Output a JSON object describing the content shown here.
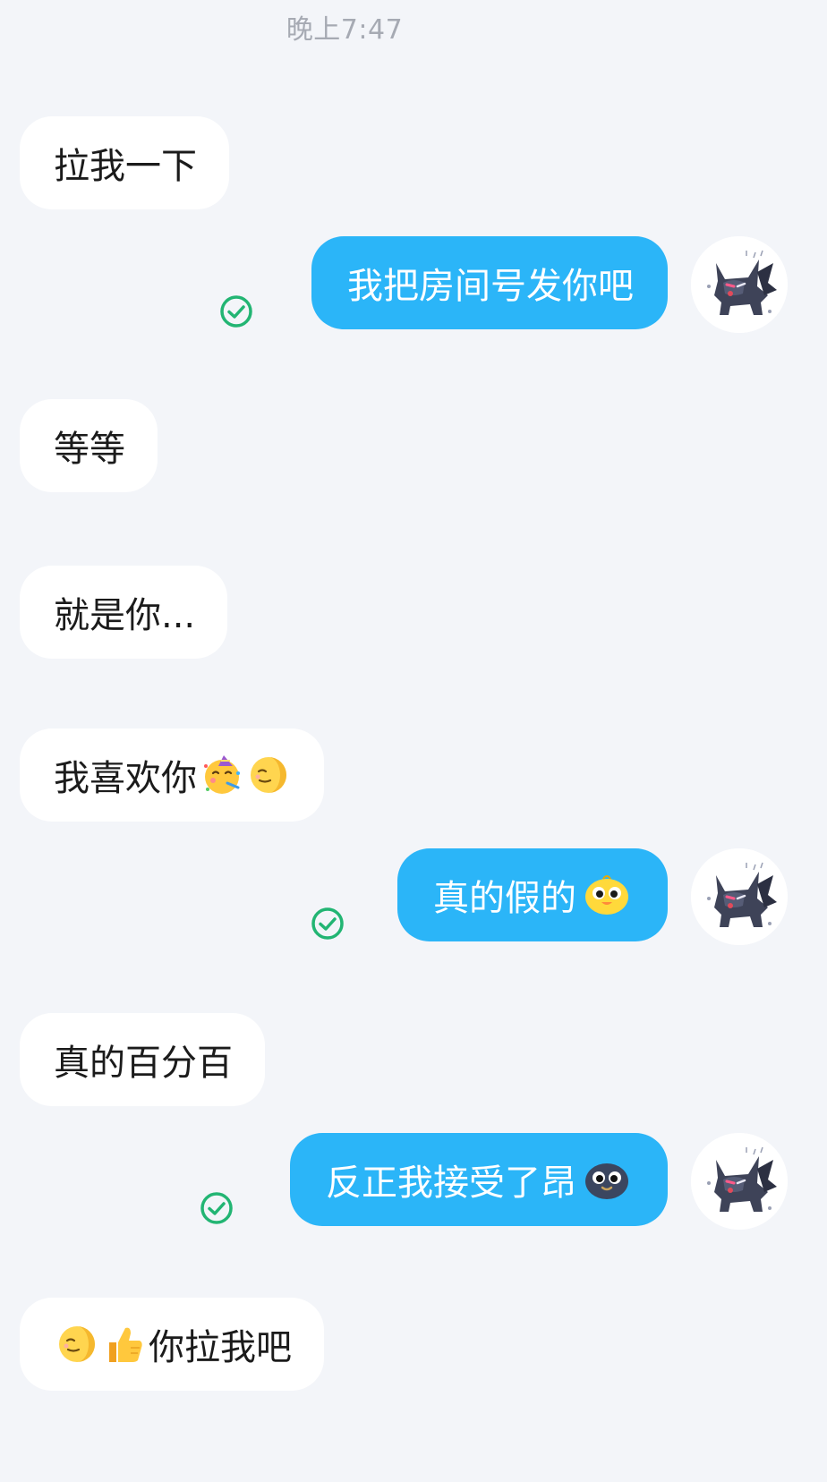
{
  "header": {
    "time": "晚上7:47"
  },
  "messages": [
    {
      "side": "in",
      "text": "拉我一下"
    },
    {
      "side": "out",
      "text": "我把房间号发你吧",
      "status": "read-check-icon"
    },
    {
      "side": "in",
      "text": "等等"
    },
    {
      "side": "in",
      "text": "就是你..."
    },
    {
      "side": "in",
      "text": "我喜欢你",
      "emojis": [
        "partying-face-emoji",
        "smirking-moon-emoji"
      ]
    },
    {
      "side": "out",
      "text": "真的假的",
      "emojis": [
        "yellow-chick-emoji"
      ],
      "status": "read-check-icon"
    },
    {
      "side": "in",
      "text": "真的百分百"
    },
    {
      "side": "out",
      "text": "反正我接受了昂",
      "emojis": [
        "dark-blob-emoji"
      ],
      "status": "read-check-icon"
    },
    {
      "side": "in",
      "text": "你拉我吧",
      "leading_emojis": [
        "smirking-moon-emoji",
        "thumbs-up-emoji"
      ]
    }
  ],
  "colors": {
    "background": "#f3f5f9",
    "incoming_bubble": "#ffffff",
    "outgoing_bubble": "#2bb5f8",
    "check": "#22b573",
    "timestamp": "#a6aab3"
  },
  "avatar": {
    "icon": "dark-cat-avatar-icon"
  }
}
